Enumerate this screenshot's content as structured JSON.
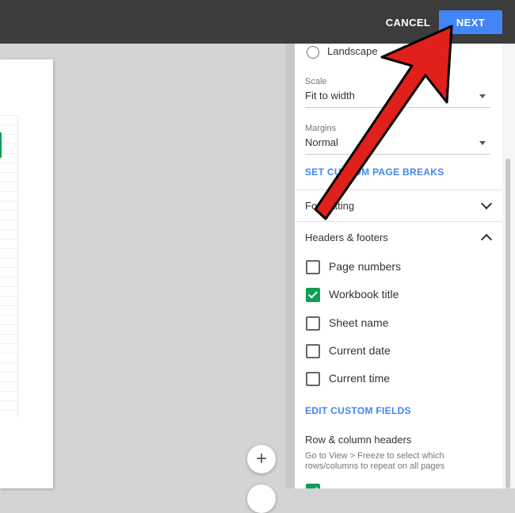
{
  "topbar": {
    "cancel": "CANCEL",
    "next": "NEXT"
  },
  "orientation": {
    "landscape": "Landscape",
    "selected": "portrait"
  },
  "scale": {
    "label": "Scale",
    "value": "Fit to width"
  },
  "margins": {
    "label": "Margins",
    "value": "Normal"
  },
  "custom_breaks": "SET CUSTOM PAGE BREAKS",
  "formatting": {
    "label": "Formatting"
  },
  "headers_footers": {
    "label": "Headers & footers",
    "items": [
      {
        "label": "Page numbers",
        "checked": false
      },
      {
        "label": "Workbook title",
        "checked": true
      },
      {
        "label": "Sheet name",
        "checked": false
      },
      {
        "label": "Current date",
        "checked": false
      },
      {
        "label": "Current time",
        "checked": false
      }
    ],
    "edit_link": "EDIT CUSTOM FIELDS"
  },
  "row_col_headers": {
    "label": "Row & column headers",
    "help": "Go to View > Freeze to select which rows/columns to repeat on all pages"
  },
  "zoom": {
    "in": "+"
  },
  "colors": {
    "accent": "#4285f4",
    "check": "#0f9d58",
    "arrow": "#e0201a",
    "topbar": "#3c3c3c"
  }
}
